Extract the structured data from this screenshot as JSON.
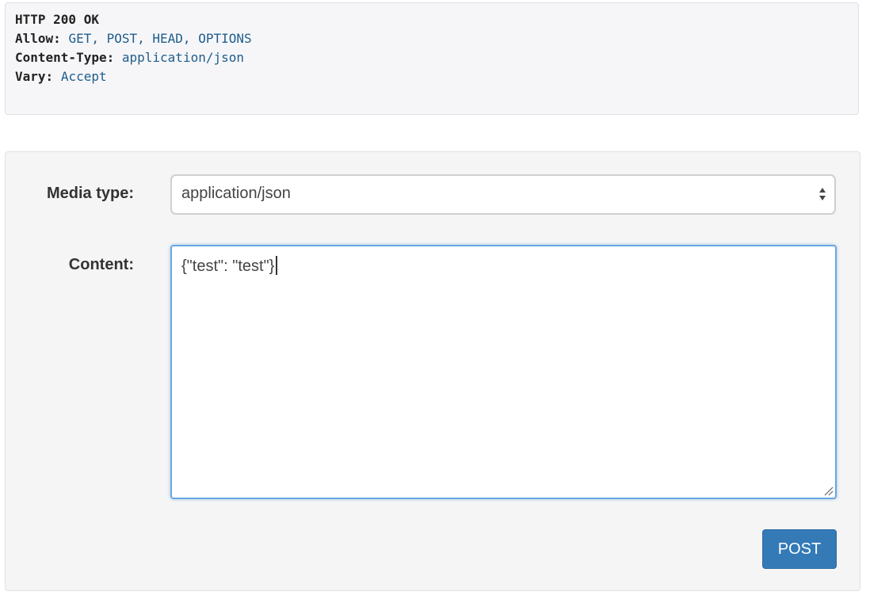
{
  "response": {
    "status": "HTTP 200 OK",
    "headers": [
      {
        "key": "Allow:",
        "value": "GET, POST, HEAD, OPTIONS"
      },
      {
        "key": "Content-Type:",
        "value": "application/json"
      },
      {
        "key": "Vary:",
        "value": "Accept"
      }
    ]
  },
  "form": {
    "media_type_label": "Media type:",
    "media_type_value": "application/json",
    "content_label": "Content:",
    "content_value": "{\"test\": \"test\"}",
    "submit_label": "POST"
  },
  "colors": {
    "header_value": "#1f5d8a",
    "button_bg": "#337ab7",
    "textarea_focus_border": "#6aa7df"
  },
  "icons": {
    "select_arrows": "up-down-chevron-icon",
    "resize_grip": "resize-grip-icon"
  }
}
